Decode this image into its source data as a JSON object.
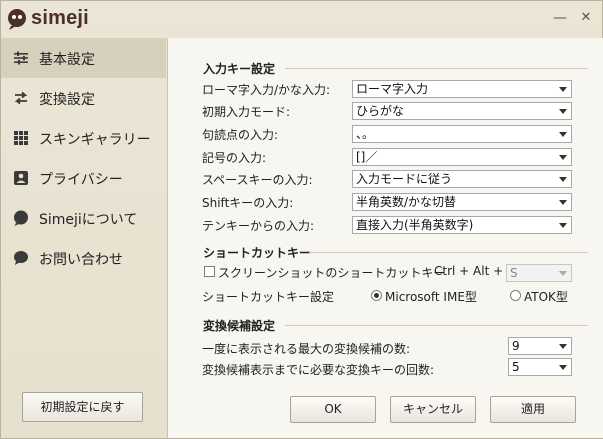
{
  "app": {
    "name": "simeji"
  },
  "window_controls": {
    "minimize": "—",
    "close": "✕"
  },
  "sidebar": {
    "items": [
      {
        "label": "基本設定",
        "icon": "sliders-icon",
        "active": true
      },
      {
        "label": "変換設定",
        "icon": "swap-arrows-icon",
        "active": false
      },
      {
        "label": "スキンギャラリー",
        "icon": "grid-icon",
        "active": false
      },
      {
        "label": "プライバシー",
        "icon": "privacy-icon",
        "active": false
      },
      {
        "label": "Simejiについて",
        "icon": "simeji-logo-icon",
        "active": false
      },
      {
        "label": "お問い合わせ",
        "icon": "chat-bubble-icon",
        "active": false
      }
    ],
    "reset_label": "初期設定に戻す"
  },
  "input_keys": {
    "title": "入力キー設定",
    "rows": [
      {
        "label": "ローマ字入力/かな入力:",
        "value": "ローマ字入力"
      },
      {
        "label": "初期入力モード:",
        "value": "ひらがな"
      },
      {
        "label": "句読点の入力:",
        "value": "、。"
      },
      {
        "label": "記号の入力:",
        "value": "[]／"
      },
      {
        "label": "スペースキーの入力:",
        "value": "入力モードに従う"
      },
      {
        "label": "Shiftキーの入力:",
        "value": "半角英数/かな切替"
      },
      {
        "label": "テンキーからの入力:",
        "value": "直接入力(半角英数字)"
      }
    ]
  },
  "shortcut": {
    "title": "ショートカットキー",
    "screenshot_label": "スクリーンショットのショートカットキー",
    "screenshot_checked": false,
    "combo_label": "Ctrl + Alt +",
    "combo_value": "S",
    "setting_label": "ショートカットキー設定",
    "options": [
      {
        "label": "Microsoft IME型",
        "checked": true
      },
      {
        "label": "ATOK型",
        "checked": false
      }
    ]
  },
  "conversion": {
    "title": "変換候補設定",
    "rows": [
      {
        "label": "一度に表示される最大の変換候補の数:",
        "value": "9"
      },
      {
        "label": "変換候補表示までに必要な変換キーの回数:",
        "value": "5"
      }
    ]
  },
  "buttons": {
    "ok": "OK",
    "cancel": "キャンセル",
    "apply": "適用"
  },
  "colors": {
    "accent_brown": "#4a3025",
    "sidebar_active": "#d7d0bc",
    "panel_bg": "#f7f6f1"
  }
}
